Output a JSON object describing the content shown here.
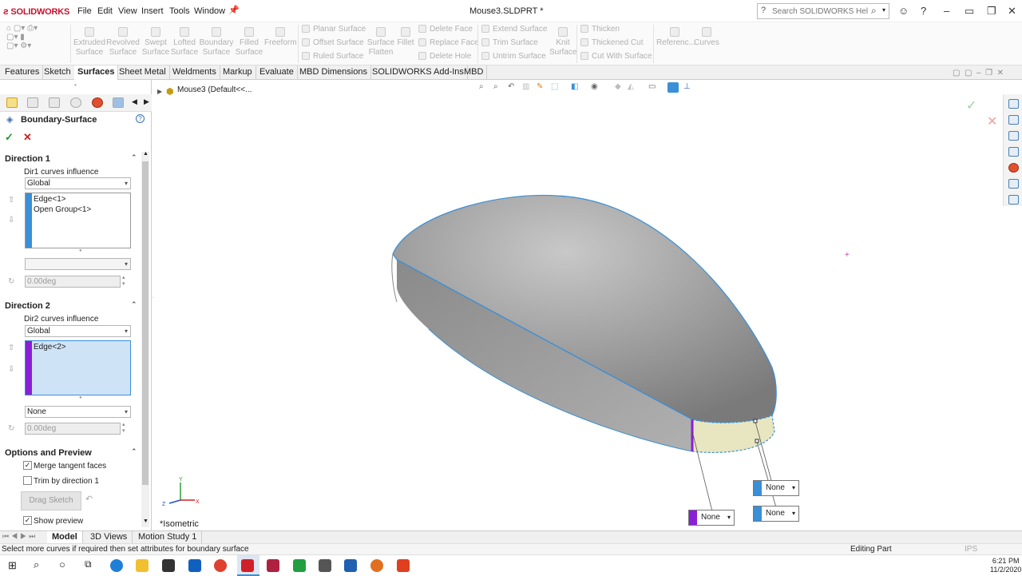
{
  "app": {
    "name": "SOLIDWORKS",
    "title": "Mouse3.SLDPRT *"
  },
  "menu": [
    "File",
    "Edit",
    "View",
    "Insert",
    "Tools",
    "Window"
  ],
  "search": {
    "placeholder": "Search SOLIDWORKS Help"
  },
  "ribbon": {
    "big": [
      "Extruded Surface",
      "Revolved Surface",
      "Swept Surface",
      "Lofted Surface",
      "Boundary Surface",
      "Filled Surface",
      "Freeform"
    ],
    "col1": [
      "Planar Surface",
      "Offset Surface",
      "Ruled Surface"
    ],
    "flatten": "Surface Flatten",
    "fillet": "Fillet",
    "col2": [
      "Delete Face",
      "Replace Face",
      "Delete Hole"
    ],
    "col3": [
      "Extend Surface",
      "Trim Surface",
      "Untrim Surface"
    ],
    "knit": "Knit Surface",
    "col4": [
      "Thicken",
      "Thickened Cut",
      "Cut With Surface"
    ],
    "reference": "Referenc...",
    "curves": "Curves"
  },
  "tabs": [
    "Features",
    "Sketch",
    "Surfaces",
    "Sheet Metal",
    "Weldments",
    "Markup",
    "Evaluate",
    "MBD Dimensions",
    "SOLIDWORKS Add-Ins",
    "MBD"
  ],
  "active_tab": "Surfaces",
  "tree_path": "Mouse3  (Default<<...",
  "pm": {
    "title": "Boundary-Surface",
    "direction1": {
      "title": "Direction 1",
      "influence_label": "Dir1 curves influence",
      "influence_value": "Global",
      "items": [
        "Edge<1>",
        "Open Group<1>"
      ],
      "angle": "0.00deg"
    },
    "direction2": {
      "title": "Direction 2",
      "influence_label": "Dir2 curves influence",
      "influence_value": "Global",
      "items": [
        "Edge<2>"
      ],
      "tangency": "None",
      "angle": "0.00deg"
    },
    "options": {
      "title": "Options and Preview",
      "merge": "Merge tangent faces",
      "trim": "Trim by direction 1",
      "drag": "Drag Sketch",
      "preview": "Show preview"
    }
  },
  "viewport": {
    "view_label": "*Isometric",
    "callout_label": "None"
  },
  "bottom_tabs": [
    "Model",
    "3D Views",
    "Motion Study 1"
  ],
  "status": {
    "message": "Select more curves if required then set attributes for boundary surface",
    "mode": "Editing Part",
    "units": "IPS"
  },
  "clock": {
    "time": "6:21 PM",
    "date": "11/2/2020"
  },
  "colors": {
    "accent": "#3a8fd6",
    "dir2": "#8a1fd6",
    "surface": "#9a9a9a"
  }
}
